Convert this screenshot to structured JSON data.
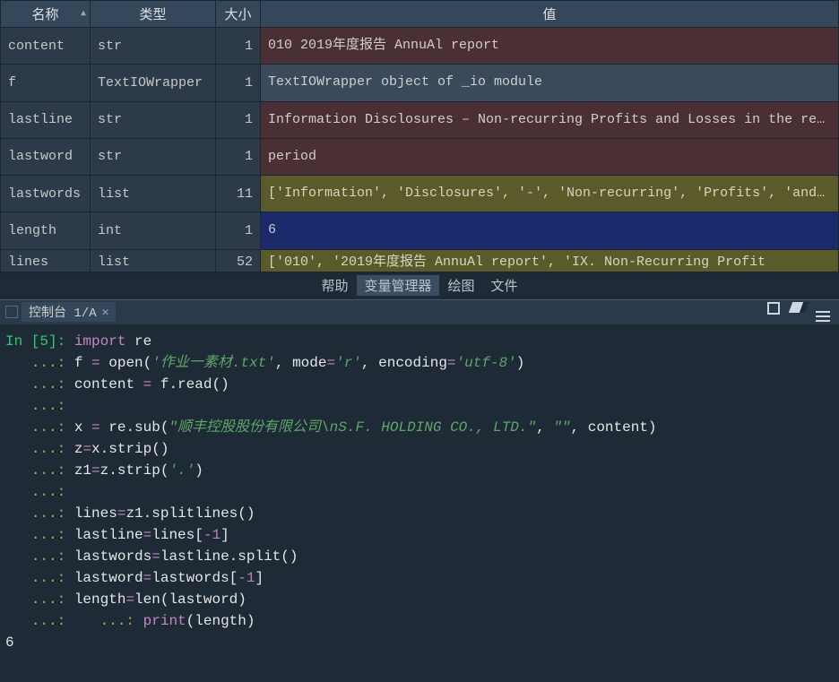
{
  "variable_explorer": {
    "columns": {
      "name": "名称",
      "type": "类型",
      "size": "大小",
      "value": "值"
    },
    "rows": [
      {
        "cls": "row-str",
        "name": "content",
        "type": "str",
        "size": "1",
        "value": "010\n2019年度报告 AnnuAl report"
      },
      {
        "cls": "row-file",
        "name": "f",
        "type": "TextIOWrapper",
        "size": "1",
        "value": "TextIOWrapper object of _io module"
      },
      {
        "cls": "row-str",
        "name": "lastline",
        "type": "str",
        "size": "1",
        "value": "Information Disclosures – Non-recurring Profits and Losses in the repo ..."
      },
      {
        "cls": "row-str",
        "name": "lastword",
        "type": "str",
        "size": "1",
        "value": "period"
      },
      {
        "cls": "row-list",
        "name": "lastwords",
        "type": "list",
        "size": "11",
        "value": "['Information', 'Disclosures', '-', 'Non-recurring', 'Profits', 'and', ..."
      },
      {
        "cls": "row-int",
        "name": "length",
        "type": "int",
        "size": "1",
        "value": "6"
      },
      {
        "cls": "row-list row-cut",
        "name": "lines",
        "type": "list",
        "size": "52",
        "value": "['010', '2019年度报告 AnnuAl report', 'IX. Non-Recurring Profit"
      }
    ]
  },
  "pane_tabs": {
    "items": [
      "帮助",
      "变量管理器",
      "绘图",
      "文件"
    ],
    "active_index": 1
  },
  "console": {
    "tab_label": "控制台 1/A",
    "prompt_in": "In [5]:",
    "continuation": "...:",
    "code": {
      "l1_import": "import",
      "l1_re": "re",
      "l2": "f = open('作业一素材.txt', mode='r', encoding='utf-8')",
      "l2_pre": "f ",
      "l2_eq": "=",
      "l2_open": " open(",
      "l2_s1": "'作业一素材.txt'",
      "l2_c1": ", mode",
      "l2_eq2": "=",
      "l2_s2": "'r'",
      "l2_c2": ", encoding",
      "l2_eq3": "=",
      "l2_s3": "'utf-8'",
      "l2_end": ")",
      "l3_pre": "content ",
      "l3_eq": "=",
      "l3_post": " f.read()",
      "l4_pre": "x ",
      "l4_eq": "=",
      "l4_mid": " re.sub(",
      "l4_s1": "\"顺丰控股股份有限公司\\nS.F. HOLDING CO., LTD.\"",
      "l4_c": ", ",
      "l4_s2": "\"\"",
      "l4_c2": ", content)",
      "l5": "z=x.strip()",
      "l5_pre": "z",
      "l5_eq": "=",
      "l5_post": "x.strip()",
      "l6_pre": "z1",
      "l6_eq": "=",
      "l6_post": "z.strip(",
      "l6_s": "'.'",
      "l6_end": ")",
      "l7_pre": "lines",
      "l7_eq": "=",
      "l7_post": "z1.splitlines()",
      "l8_pre": "lastline",
      "l8_eq": "=",
      "l8_post": "lines[",
      "l8_num": "-1",
      "l8_end": "]",
      "l9_pre": "lastwords",
      "l9_eq": "=",
      "l9_post": "lastline.split()",
      "l10_pre": "lastword",
      "l10_eq": "=",
      "l10_post": "lastwords[",
      "l10_num": "-1",
      "l10_end": "]",
      "l11_pre": "length",
      "l11_eq": "=",
      "l11_post": "len(lastword)",
      "l12_pre": "",
      "l12_print": "print",
      "l12_post": "(length)"
    },
    "output": "6"
  }
}
